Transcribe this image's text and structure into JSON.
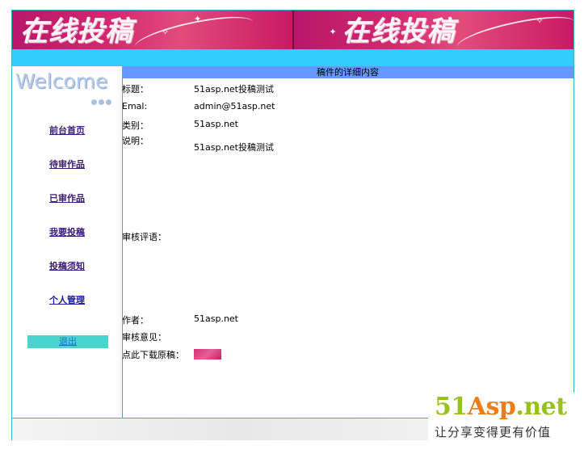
{
  "banner": {
    "text_left": "在线投稿",
    "text_right": "在线投稿"
  },
  "sidebar": {
    "welcome": "Welcome",
    "nav": [
      {
        "label": "前台首页"
      },
      {
        "label": "待审作品"
      },
      {
        "label": "已审作品"
      },
      {
        "label": "我要投稿"
      },
      {
        "label": "投稿须知"
      },
      {
        "label": "个人管理"
      }
    ],
    "logout": "退出"
  },
  "content": {
    "header": "稿件的详细内容",
    "fields": {
      "title_label": "标题：",
      "title_value": "51asp.net投稿测试",
      "email_label": "Emal:",
      "email_value": "admin@51asp.net",
      "category_label": "类别：",
      "category_value": "51asp.net",
      "desc_label": "说明：",
      "desc_value": "51asp.net投稿测试",
      "review_comment_label": "审核评语：",
      "author_label": "作者：",
      "author_value": "51asp.net",
      "review_opinion_label": "审核意见：",
      "download_label": "点此下载原稿："
    }
  },
  "watermark": {
    "brand_num": "51",
    "brand_asp": "Asp",
    "brand_dot": ".",
    "brand_net": "net",
    "slogan": "让分享变得更有价值"
  },
  "colors": {
    "accent_bar": "#33ccff",
    "content_header": "#6699ff",
    "logout_bg": "#4ad3cf"
  }
}
